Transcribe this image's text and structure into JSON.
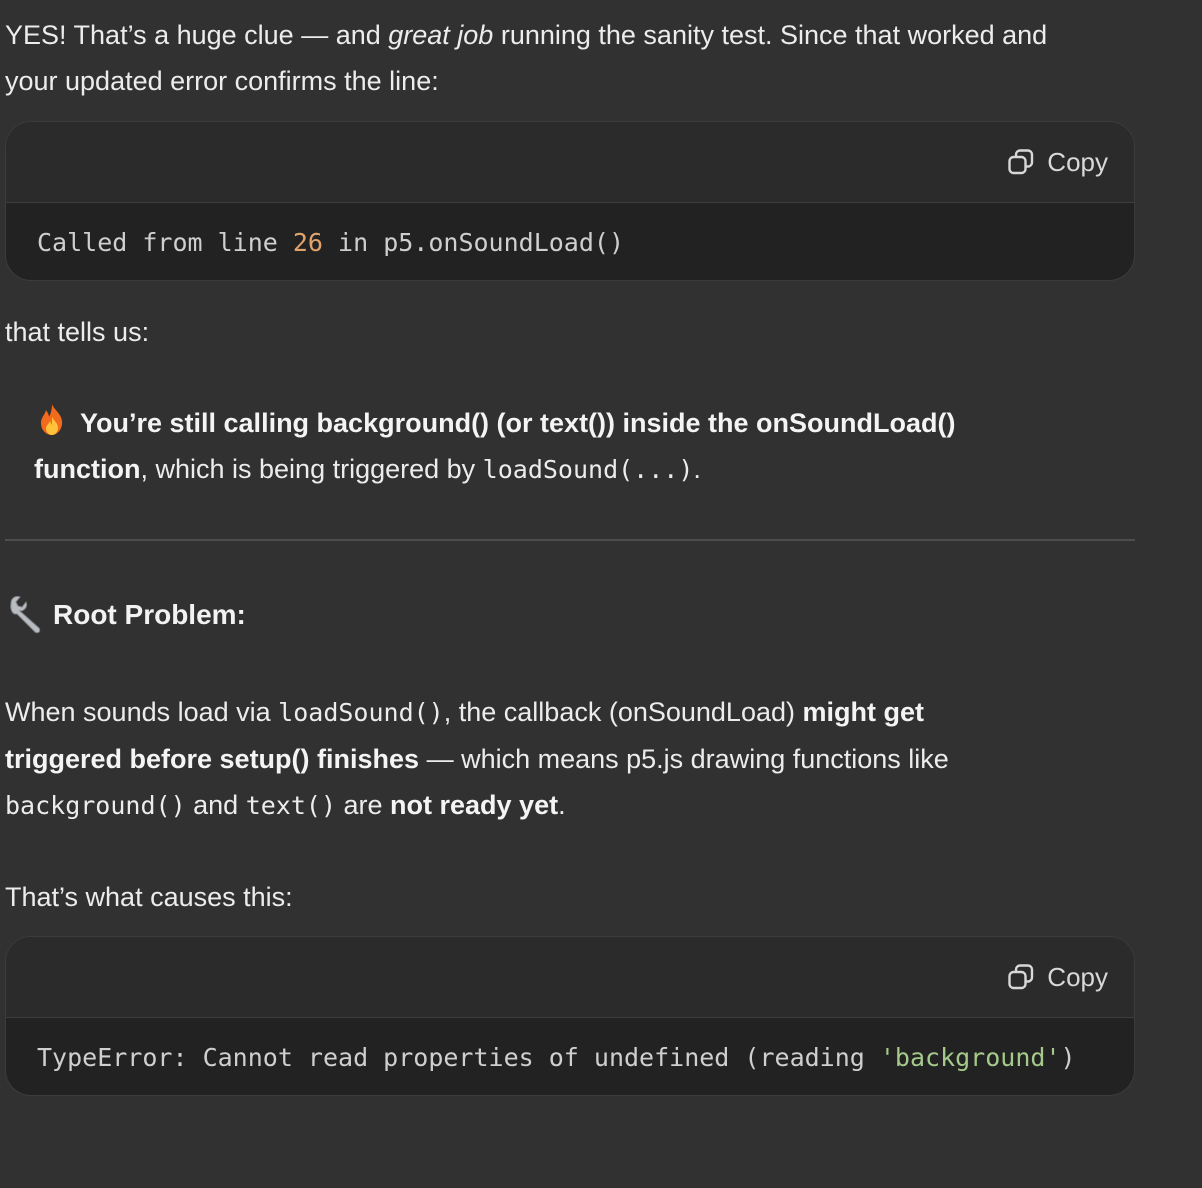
{
  "intro": {
    "line1_a": "YES! That’s a huge clue — and ",
    "line1_italic": "great job",
    "line1_b": " running the sanity test. Since that worked and",
    "line2": "your updated error confirms the line:"
  },
  "code_block_1": {
    "copy_label": "Copy",
    "code_a": "Called from line ",
    "code_number": "26",
    "code_b": " in p5.onSoundLoad()"
  },
  "tells_us": "that tells us:",
  "callout": {
    "icon": "fire-icon",
    "bold_1": "You’re still calling background() (or text()) inside the onSoundLoad()",
    "bold_2": "function",
    "text_2": ", which is being triggered by ",
    "code": "loadSound(...)",
    "end": "."
  },
  "heading": {
    "icon": "wrench-icon",
    "text": "Root Problem:"
  },
  "root_para": {
    "l1_a": "When sounds load via ",
    "l1_code": "loadSound()",
    "l1_b": ", the callback (onSoundLoad) ",
    "l1_bold": "might get",
    "l2_bold": "triggered before setup() finishes",
    "l2_b": " — which means p5.js drawing functions like",
    "l3_code1": "background()",
    "l3_and": " and ",
    "l3_code2": "text()",
    "l3_are": " are ",
    "l3_bold": "not ready yet",
    "l3_end": "."
  },
  "causes": "That’s what causes this:",
  "code_block_2": {
    "copy_label": "Copy",
    "code_a": "TypeError: Cannot read properties of undefined (reading ",
    "code_string": "'background'",
    "code_end": ")"
  },
  "colors": {
    "background": "#313131",
    "code_bg": "#222222",
    "code_header": "#2b2b2b",
    "number": "#e0a36b",
    "string": "#a5c98a"
  }
}
